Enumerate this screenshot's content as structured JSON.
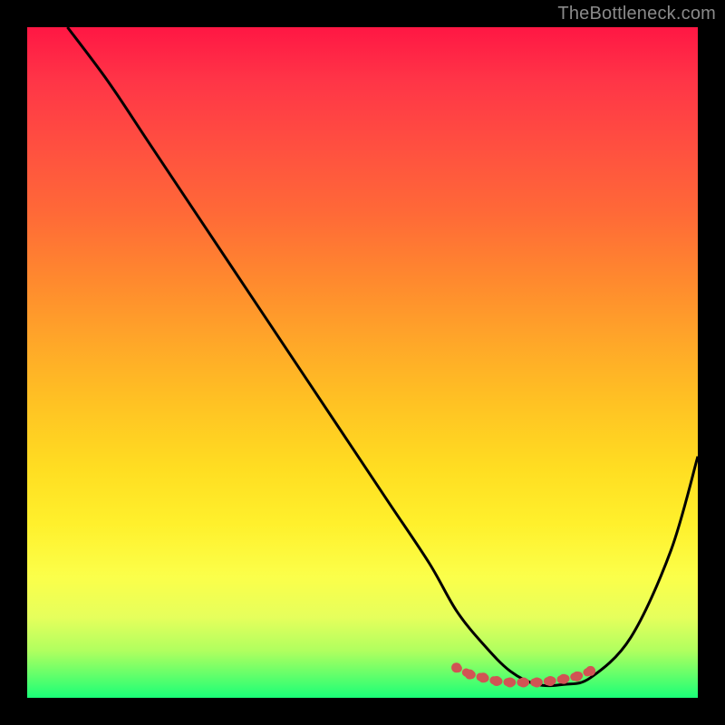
{
  "watermark": "TheBottleneck.com",
  "colors": {
    "background": "#000000",
    "curve_main": "#000000",
    "accent_dots": "#d15454"
  },
  "chart_data": {
    "type": "line",
    "title": "",
    "xlabel": "",
    "ylabel": "",
    "xlim": [
      0,
      100
    ],
    "ylim": [
      0,
      100
    ],
    "grid": false,
    "legend": false,
    "series": [
      {
        "name": "main-curve",
        "x": [
          6,
          12,
          18,
          24,
          30,
          36,
          42,
          48,
          54,
          60,
          64,
          68,
          72,
          76,
          80,
          84,
          90,
          96,
          100
        ],
        "y": [
          100,
          92,
          83,
          74,
          65,
          56,
          47,
          38,
          29,
          20,
          13,
          8,
          4,
          2,
          2,
          3,
          9,
          22,
          36
        ]
      }
    ],
    "accent_cluster": {
      "name": "valley-dots",
      "x": [
        64,
        66,
        68,
        70,
        72,
        74,
        76,
        78,
        80,
        82,
        84
      ],
      "y": [
        4.5,
        3.5,
        3.0,
        2.5,
        2.3,
        2.3,
        2.3,
        2.5,
        2.8,
        3.2,
        4.0
      ]
    }
  }
}
